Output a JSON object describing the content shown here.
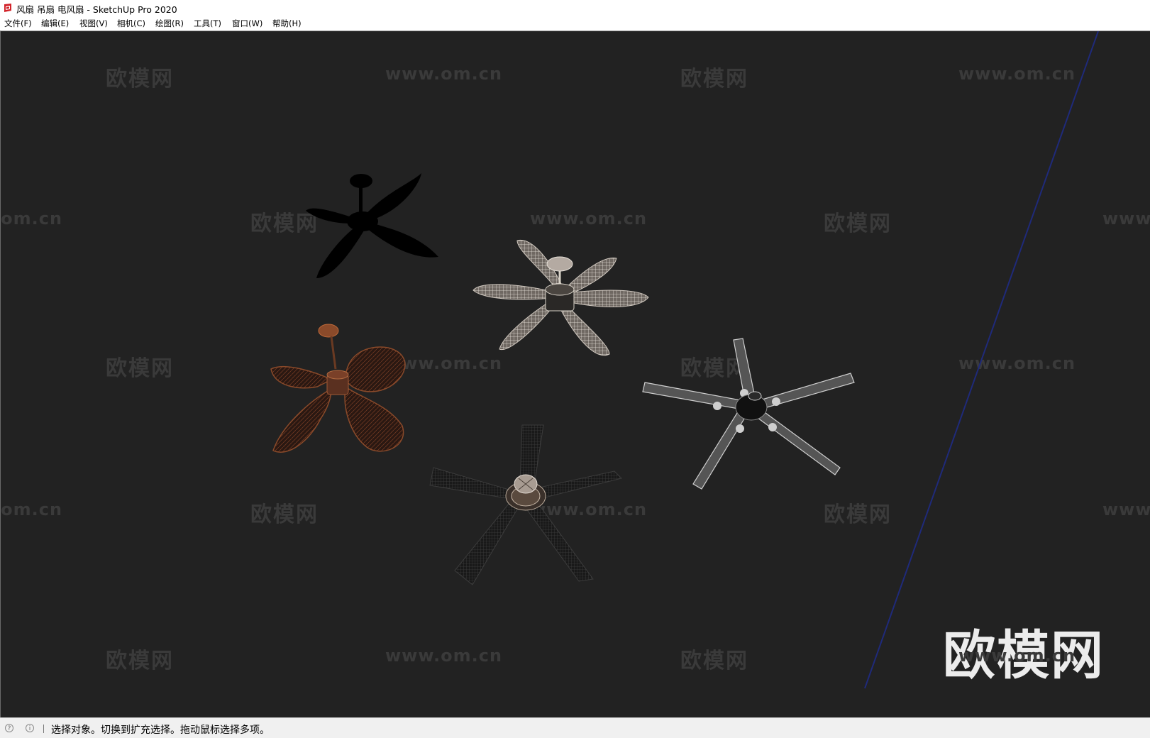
{
  "window": {
    "title": "风扇 吊扇 电风扇 - SketchUp Pro 2020",
    "icon": "sketchup-icon"
  },
  "menu": [
    {
      "label": "文件(F)"
    },
    {
      "label": "编辑(E)"
    },
    {
      "label": "视图(V)"
    },
    {
      "label": "相机(C)"
    },
    {
      "label": "绘图(R)"
    },
    {
      "label": "工具(T)"
    },
    {
      "label": "窗口(W)"
    },
    {
      "label": "帮助(H)"
    }
  ],
  "viewport": {
    "background": "#222222",
    "watermark": {
      "brand": "欧模网",
      "url": "www.om.cn"
    },
    "logo": {
      "text": "欧模网",
      "url": "www.om.cn"
    },
    "axis_color": "#1f2a7a"
  },
  "status": {
    "icons": [
      "geolocation-icon",
      "info-icon"
    ],
    "message": "选择对象。切换到扩充选择。拖动鼠标选择多项。"
  }
}
